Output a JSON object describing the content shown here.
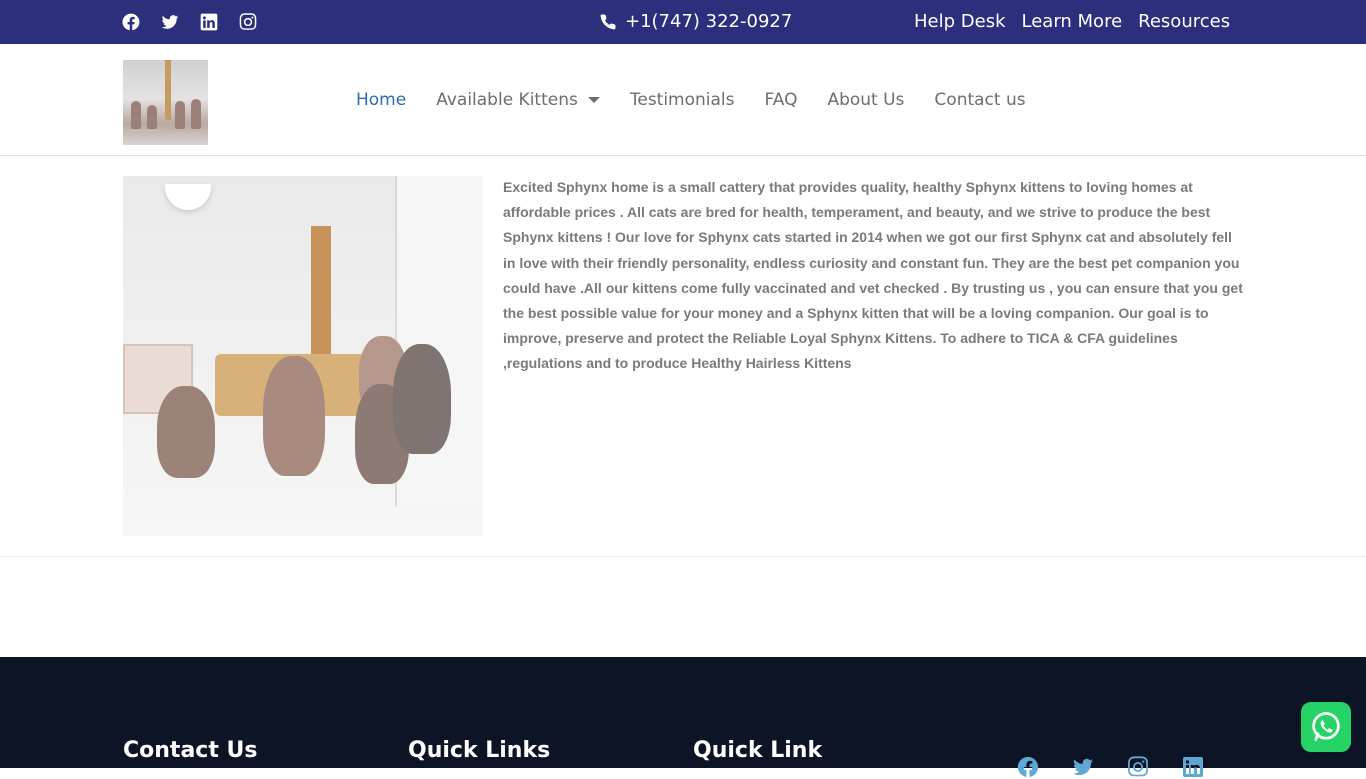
{
  "topbar": {
    "social_icons": [
      "facebook-icon",
      "twitter-icon",
      "linkedin-icon",
      "instagram-icon"
    ],
    "phone": "+1(747) 322-0927",
    "links": [
      "Help Desk",
      "Learn More",
      "Resources"
    ]
  },
  "nav": {
    "items": [
      "Home",
      "Available Kittens",
      "Testimonials",
      "FAQ",
      "About Us",
      "Contact us"
    ],
    "active": "Home"
  },
  "about": {
    "text": "Excited Sphynx home is a small cattery that provides quality, healthy Sphynx kittens to loving homes at affordable prices . All cats are bred for health, temperament, and beauty, and we strive to produce the best Sphynx kittens ! Our love for Sphynx cats started in 2014 when we got our first Sphynx cat and absolutely fell in love with their friendly personality, endless curiosity and constant fun. They are the best pet companion you could have .All our kittens come fully vaccinated and vet checked . By trusting us , you can ensure that you get the best possible value for your money and a Sphynx kitten that will be a loving companion. Our goal is to improve, preserve and protect the Reliable Loyal Sphynx Kittens. To adhere to TICA & CFA guidelines ,regulations and to produce Healthy Hairless Kittens"
  },
  "footer": {
    "headings": [
      "Contact Us",
      "Quick Links",
      "Quick Link"
    ],
    "social_icons": [
      "facebook-icon",
      "twitter-icon",
      "instagram-icon",
      "linkedin-icon"
    ]
  },
  "colors": {
    "topbar_bg": "#2c2f7c",
    "nav_active": "#2b6cb0",
    "footer_bg": "#0c1426",
    "whatsapp": "#25d366"
  }
}
